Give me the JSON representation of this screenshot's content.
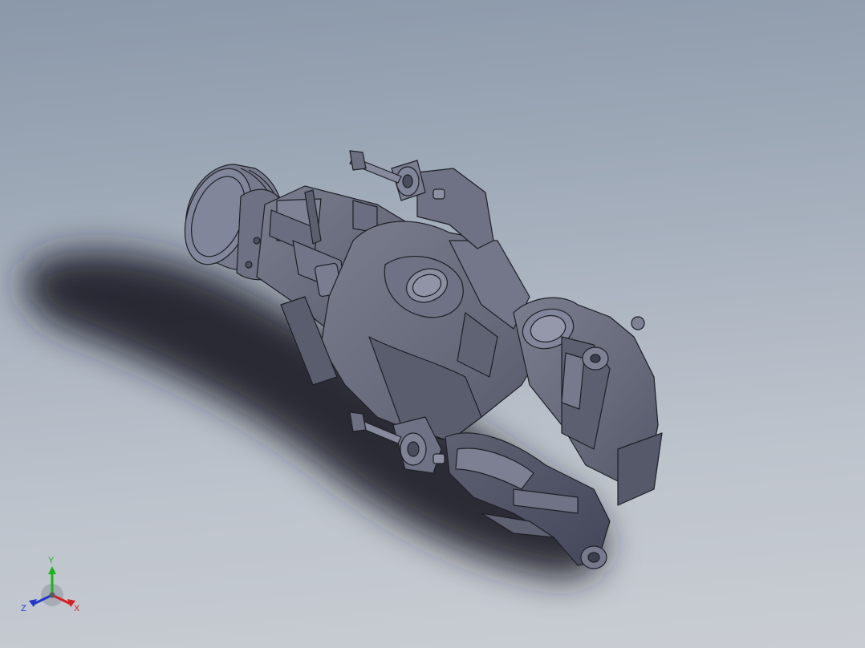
{
  "viewport": {
    "background_top": "#8a98a9",
    "background_bottom": "#c9cdd3",
    "model_color": "#6c6f80",
    "edge_color": "#1e1f26"
  },
  "triad": {
    "x_label": "X",
    "y_label": "Y",
    "z_label": "Z",
    "x_color": "#d42020",
    "y_color": "#18b418",
    "z_color": "#2238c8"
  }
}
